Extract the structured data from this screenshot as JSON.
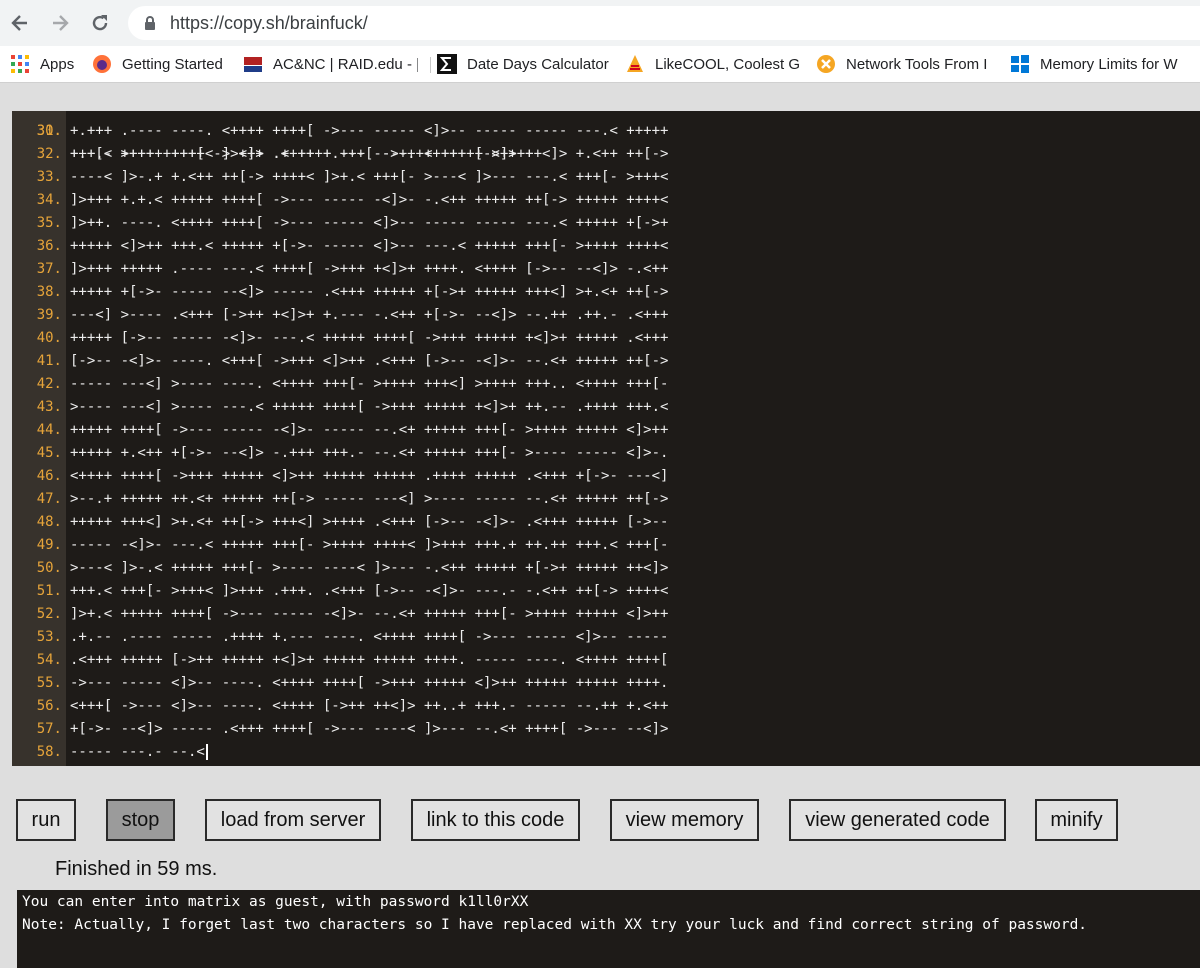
{
  "browser": {
    "url": "https://copy.sh/brainfuck/",
    "bookmarks": [
      {
        "label": "Apps",
        "icon": "apps-grid-icon"
      },
      {
        "label": "Getting Started",
        "icon": "firefox-icon"
      },
      {
        "label": "AC&NC | RAID.edu - |",
        "icon": "raid-logo-icon"
      },
      {
        "label": "Date Days Calculator",
        "icon": "sigma-icon"
      },
      {
        "label": "LikeCOOL, Coolest Ga",
        "icon": "likecool-icon"
      },
      {
        "label": "Network Tools From I",
        "icon": "network-tools-icon"
      },
      {
        "label": "Memory Limits for W",
        "icon": "windows-icon"
      }
    ]
  },
  "editor": {
    "partial_top_line": "+.+.< ++++ ++++[ -> <]> .< ++++ +++[ ->++++ +++++ <]>++",
    "partial_top_number": "30.",
    "lines": [
      {
        "n": "31.",
        "code": "+.+++ .---- ----. <++++ ++++[ ->--- ----- <]>-- ----- ----- ---.< +++++"
      },
      {
        "n": "32.",
        "code": "+++[- >++++ ++++< ]>+++ .++++ +.--- ----. <++++ [->++ ++<]> +.<++ ++[->"
      },
      {
        "n": "33.",
        "code": "----< ]>-.+ +.<++ ++[-> ++++< ]>+.< +++[- >---< ]>--- ---.< +++[- >+++<"
      },
      {
        "n": "34.",
        "code": "]>+++ +.+.< +++++ ++++[ ->--- ----- -<]>- -.<++ +++++ ++[-> +++++ ++++<"
      },
      {
        "n": "35.",
        "code": "]>++. ----. <++++ ++++[ ->--- ----- <]>-- ----- ----- ---.< +++++ +[->+"
      },
      {
        "n": "36.",
        "code": "+++++ <]>++ +++.< +++++ +[->- ----- <]>-- ---.< +++++ +++[- >++++ ++++<"
      },
      {
        "n": "37.",
        "code": "]>+++ +++++ .---- ---.< ++++[ ->+++ +<]>+ ++++. <++++ [->-- --<]> -.<++"
      },
      {
        "n": "38.",
        "code": "+++++ +[->- ----- --<]> ----- .<+++ +++++ +[->+ +++++ +++<] >+.<+ ++[->"
      },
      {
        "n": "39.",
        "code": "---<] >---- .<+++ [->++ +<]>+ +.--- -.<++ +[->- --<]> --.++ .++.- .<+++"
      },
      {
        "n": "40.",
        "code": "+++++ [->-- ----- -<]>- ---.< +++++ ++++[ ->+++ +++++ +<]>+ +++++ .<+++"
      },
      {
        "n": "41.",
        "code": "[->-- -<]>- ----. <+++[ ->+++ <]>++ .<+++ [->-- -<]>- --.<+ +++++ ++[->"
      },
      {
        "n": "42.",
        "code": "----- ---<] >---- ----. <++++ +++[- >++++ +++<] >++++ +++.. <++++ +++[-"
      },
      {
        "n": "43.",
        "code": ">---- ---<] >---- ---.< +++++ ++++[ ->+++ +++++ +<]>+ ++.-- .++++ +++.<"
      },
      {
        "n": "44.",
        "code": "+++++ ++++[ ->--- ----- -<]>- ----- --.<+ +++++ +++[- >++++ +++++ <]>++"
      },
      {
        "n": "45.",
        "code": "+++++ +.<++ +[->- --<]> -.+++ +++.- --.<+ +++++ +++[- >---- ----- <]>-."
      },
      {
        "n": "46.",
        "code": "<++++ ++++[ ->+++ +++++ <]>++ +++++ +++++ .++++ +++++ .<+++ +[->- ---<]"
      },
      {
        "n": "47.",
        "code": ">--.+ +++++ ++.<+ +++++ ++[-> ----- ---<] >---- ----- --.<+ +++++ ++[->"
      },
      {
        "n": "48.",
        "code": "+++++ +++<] >+.<+ ++[-> +++<] >++++ .<+++ [->-- -<]>- .<+++ +++++ [->--"
      },
      {
        "n": "49.",
        "code": "----- -<]>- ---.< +++++ +++[- >++++ ++++< ]>+++ +++.+ ++.++ +++.< +++[-"
      },
      {
        "n": "50.",
        "code": ">---< ]>-.< +++++ +++[- >---- ----< ]>--- -.<++ +++++ +[->+ +++++ ++<]>"
      },
      {
        "n": "51.",
        "code": "+++.< +++[- >+++< ]>+++ .+++. .<+++ [->-- -<]>- ---.- -.<++ ++[-> ++++<"
      },
      {
        "n": "52.",
        "code": "]>+.< +++++ ++++[ ->--- ----- -<]>- --.<+ +++++ +++[- >++++ +++++ <]>++"
      },
      {
        "n": "53.",
        "code": ".+.-- .---- ----- .++++ +.--- ----. <++++ ++++[ ->--- ----- <]>-- -----"
      },
      {
        "n": "54.",
        "code": ".<+++ +++++ [->++ +++++ +<]>+ +++++ +++++ ++++. ----- ----. <++++ ++++["
      },
      {
        "n": "55.",
        "code": "->--- ----- <]>-- ----. <++++ ++++[ ->+++ +++++ <]>++ +++++ +++++ ++++."
      },
      {
        "n": "56.",
        "code": "<+++[ ->--- <]>-- ----. <++++ [->++ ++<]> ++..+ +++.- ----- --.++ +.<++"
      },
      {
        "n": "57.",
        "code": "+[->- --<]> ----- .<+++ ++++[ ->--- ----< ]>--- --.<+ ++++[ ->--- --<]>"
      },
      {
        "n": "58.",
        "code": "----- ---.- --.<"
      }
    ]
  },
  "buttons": {
    "run": "run",
    "stop": "stop",
    "load": "load from server",
    "link": "link to this code",
    "memory": "view memory",
    "generated": "view generated code",
    "minify": "minify"
  },
  "status": "Finished in 59 ms.",
  "output": {
    "line1": "You can enter into matrix as guest, with password k1ll0rXX",
    "line2": "Note: Actually, I forget last two characters so I have replaced with XX try your luck and find correct string of password."
  }
}
